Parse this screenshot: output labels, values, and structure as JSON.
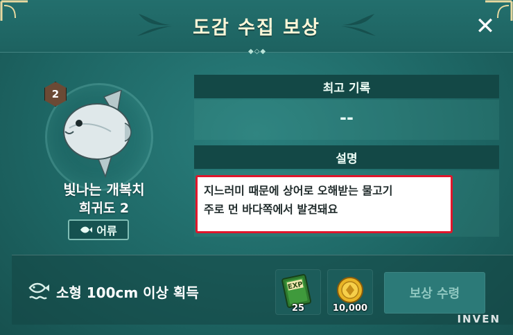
{
  "header": {
    "title": "도감 수집 보상"
  },
  "fish": {
    "grade": "2",
    "name": "빛나는 개복치",
    "rarity": "희귀도 2",
    "category": "어류"
  },
  "record": {
    "heading": "최고 기록",
    "value": "--"
  },
  "description": {
    "heading": "설명",
    "line1": "지느러미 때문에 상어로 오해받는 물고기",
    "line2": "주로 먼 바다쪽에서 발견돼요"
  },
  "reward": {
    "condition": "소형 100cm 이상 획득",
    "items": [
      {
        "icon": "exp-book-icon",
        "qty": "25"
      },
      {
        "icon": "gold-coin-icon",
        "qty": "10,000"
      }
    ],
    "claim_label": "보상 수령"
  },
  "watermark": "INVEN",
  "colors": {
    "accent": "#1f6e6c",
    "highlight": "#e0162b"
  }
}
